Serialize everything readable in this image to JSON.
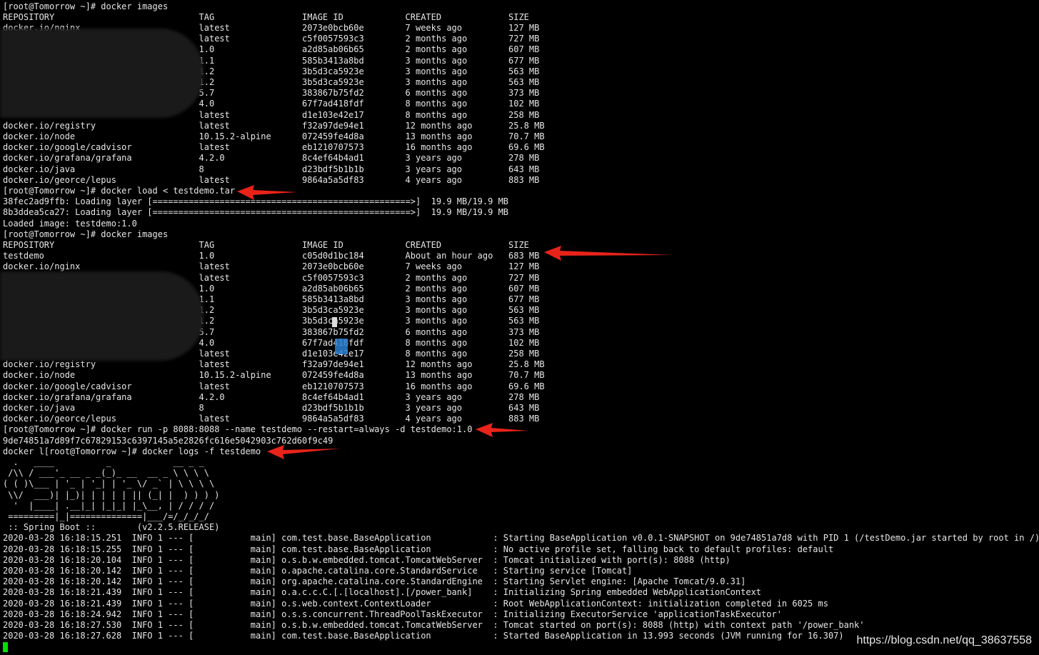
{
  "prompt": "[root@Tomorrow ~]# ",
  "commands": {
    "images1": "docker images",
    "load": "docker load < testdemo.tar",
    "images2": "docker images",
    "run": "docker run -p 8088:8088 --name testdemo --restart=always -d testdemo:1.0",
    "logs_prefix": "docker l",
    "logs": "docker logs -f testdemo"
  },
  "table_headers": [
    "REPOSITORY",
    "TAG",
    "IMAGE ID",
    "CREATED",
    "SIZE"
  ],
  "images_before": [
    [
      "docker.io/nginx",
      "latest",
      "2073e0bcb60e",
      "7 weeks ago",
      "127 MB"
    ],
    [
      "",
      "latest",
      "c5f0057593c3",
      "2 months ago",
      "727 MB"
    ],
    [
      "",
      "1.0",
      "a2d85ab06b65",
      "2 months ago",
      "607 MB"
    ],
    [
      "",
      "1.1",
      "585b3413a8bd",
      "3 months ago",
      "677 MB"
    ],
    [
      "",
      "1.2",
      "3b5d3ca5923e",
      "3 months ago",
      "563 MB"
    ],
    [
      "",
      "1.2",
      "3b5d3ca5923e",
      "3 months ago",
      "563 MB"
    ],
    [
      "",
      "5.7",
      "383867b75fd2",
      "6 months ago",
      "373 MB"
    ],
    [
      "",
      "4.0",
      "67f7ad418fdf",
      "8 months ago",
      "102 MB"
    ],
    [
      "",
      "latest",
      "d1e103e42e17",
      "8 months ago",
      "258 MB"
    ],
    [
      "docker.io/registry",
      "latest",
      "f32a97de94e1",
      "12 months ago",
      "25.8 MB"
    ],
    [
      "docker.io/node",
      "10.15.2-alpine",
      "072459fe4d8a",
      "13 months ago",
      "70.7 MB"
    ],
    [
      "docker.io/google/cadvisor",
      "latest",
      "eb1210707573",
      "16 months ago",
      "69.6 MB"
    ],
    [
      "docker.io/grafana/grafana",
      "4.2.0",
      "8c4ef64b4ad1",
      "3 years ago",
      "278 MB"
    ],
    [
      "docker.io/java",
      "8",
      "d23bdf5b1b1b",
      "3 years ago",
      "643 MB"
    ],
    [
      "docker.io/georce/lepus",
      "latest",
      "9864a5a5df83",
      "4 years ago",
      "883 MB"
    ]
  ],
  "load_output": [
    "38fec2ad9ffb: Loading layer [==================================================>]  19.9 MB/19.9 MB",
    "8b3ddea5ca27: Loading layer [==================================================>]  19.9 MB/19.9 MB",
    "Loaded image: testdemo:1.0"
  ],
  "images_after": [
    [
      "testdemo",
      "1.0",
      "c05d0d1bc184",
      "About an hour ago",
      "683 MB"
    ],
    [
      "docker.io/nginx",
      "latest",
      "2073e0bcb60e",
      "7 weeks ago",
      "127 MB"
    ],
    [
      "",
      "latest",
      "c5f0057593c3",
      "2 months ago",
      "727 MB"
    ],
    [
      "",
      "1.0",
      "a2d85ab06b65",
      "2 months ago",
      "607 MB"
    ],
    [
      "",
      "1.1",
      "585b3413a8bd",
      "3 months ago",
      "677 MB"
    ],
    [
      "",
      "1.2",
      "3b5d3ca5923e",
      "3 months ago",
      "563 MB"
    ],
    [
      "",
      "1.2",
      "3b5d3ca5923e",
      "3 months ago",
      "563 MB"
    ],
    [
      "",
      "5.7",
      "383867b75fd2",
      "6 months ago",
      "373 MB"
    ],
    [
      "",
      "4.0",
      "67f7ad418fdf",
      "8 months ago",
      "102 MB"
    ],
    [
      "",
      "latest",
      "d1e103e42e17",
      "8 months ago",
      "258 MB"
    ],
    [
      "docker.io/registry",
      "latest",
      "f32a97de94e1",
      "12 months ago",
      "25.8 MB"
    ],
    [
      "docker.io/node",
      "10.15.2-alpine",
      "072459fe4d8a",
      "13 months ago",
      "70.7 MB"
    ],
    [
      "docker.io/google/cadvisor",
      "latest",
      "eb1210707573",
      "16 months ago",
      "69.6 MB"
    ],
    [
      "docker.io/grafana/grafana",
      "4.2.0",
      "8c4ef64b4ad1",
      "3 years ago",
      "278 MB"
    ],
    [
      "docker.io/java",
      "8",
      "d23bdf5b1b1b",
      "3 years ago",
      "643 MB"
    ],
    [
      "docker.io/georce/lepus",
      "latest",
      "9864a5a5df83",
      "4 years ago",
      "883 MB"
    ]
  ],
  "container_id": "9de74851a7d89f7c67829153c6397145a5e2826fc616e5042903c762d60f9c49",
  "spring_banner": [
    "  .   ____          _            __ _ _",
    " /\\\\ / ___'_ __ _ _(_)_ __  __ _ \\ \\ \\ \\",
    "( ( )\\___ | '_ | '_| | '_ \\/ _` | \\ \\ \\ \\",
    " \\\\/  ___)| |_)| | | | | || (_| |  ) ) ) )",
    "  '  |____| .__|_| |_|_| |_\\__, | / / / /",
    " =========|_|==============|___/=/_/_/_/",
    " :: Spring Boot ::        (v2.2.5.RELEASE)"
  ],
  "logs": [
    [
      "2020-03-28 16:18:15.251",
      "INFO",
      "1",
      "main",
      "com.test.base.BaseApplication",
      "Starting BaseApplication v0.0.1-SNAPSHOT on 9de74851a7d8 with PID 1 (/testDemo.jar started by root in /)"
    ],
    [
      "2020-03-28 16:18:15.255",
      "INFO",
      "1",
      "main",
      "com.test.base.BaseApplication",
      "No active profile set, falling back to default profiles: default"
    ],
    [
      "2020-03-28 16:18:20.104",
      "INFO",
      "1",
      "main",
      "o.s.b.w.embedded.tomcat.TomcatWebServer",
      "Tomcat initialized with port(s): 8088 (http)"
    ],
    [
      "2020-03-28 16:18:20.142",
      "INFO",
      "1",
      "main",
      "o.apache.catalina.core.StandardService",
      "Starting service [Tomcat]"
    ],
    [
      "2020-03-28 16:18:20.142",
      "INFO",
      "1",
      "main",
      "org.apache.catalina.core.StandardEngine",
      "Starting Servlet engine: [Apache Tomcat/9.0.31]"
    ],
    [
      "2020-03-28 16:18:21.439",
      "INFO",
      "1",
      "main",
      "o.a.c.c.C.[.[localhost].[/power_bank]",
      "Initializing Spring embedded WebApplicationContext"
    ],
    [
      "2020-03-28 16:18:21.439",
      "INFO",
      "1",
      "main",
      "o.s.web.context.ContextLoader",
      "Root WebApplicationContext: initialization completed in 6025 ms"
    ],
    [
      "2020-03-28 16:18:24.942",
      "INFO",
      "1",
      "main",
      "o.s.s.concurrent.ThreadPoolTaskExecutor",
      "Initializing ExecutorService 'applicationTaskExecutor'"
    ],
    [
      "2020-03-28 16:18:27.530",
      "INFO",
      "1",
      "main",
      "o.s.b.w.embedded.tomcat.TomcatWebServer",
      "Tomcat started on port(s): 8088 (http) with context path '/power_bank'"
    ],
    [
      "2020-03-28 16:18:27.628",
      "INFO",
      "1",
      "main",
      "com.test.base.BaseApplication",
      "Started BaseApplication in 13.993 seconds (JVM running for 16.307)"
    ]
  ],
  "watermark": "https://blog.csdn.net/qq_38637558",
  "colors": {
    "background": "#000000",
    "text": "#e6e6e6",
    "arrow": "#e8231a",
    "cursor": "#00e000"
  }
}
